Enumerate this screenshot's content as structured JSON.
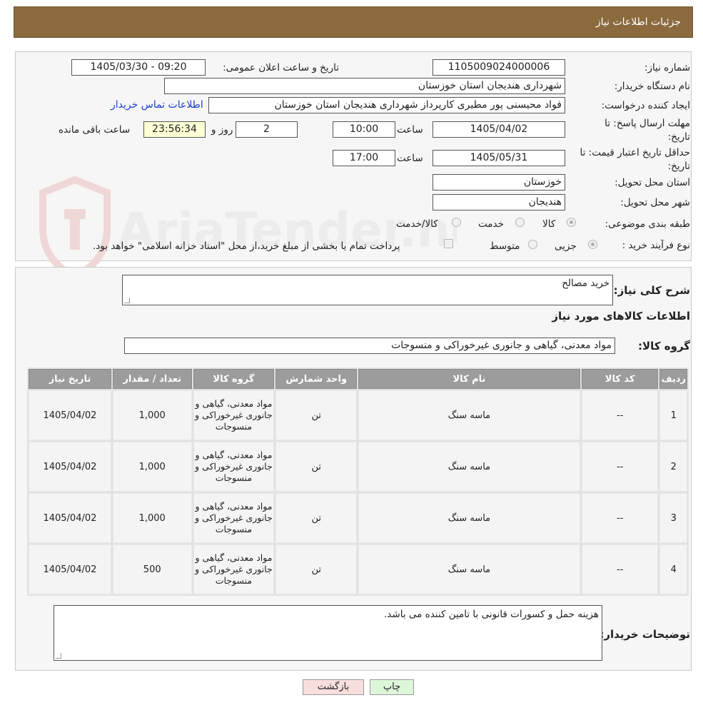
{
  "header": {
    "title": "جزئیات اطلاعات نیاز"
  },
  "form": {
    "need_number_label": "شماره نیاز:",
    "need_number": "1105009024000006",
    "announce_label": "تاریخ و ساعت اعلان عمومی:",
    "announce_value": "1405/03/30 - 09:20",
    "buyer_org_label": "نام دستگاه خریدار:",
    "buyer_org": "شهرداری هندیجان استان خوزستان",
    "requester_label": "ایجاد کننده درخواست:",
    "requester": "فواد محیسنی پور مطیری کارپرداز شهرداری هندیجان استان خوزستان",
    "contact_link": "اطلاعات تماس خریدار",
    "deadline_label": "مهلت ارسال پاسخ: تا تاریخ:",
    "deadline_date": "1405/04/02",
    "time_label": "ساعت",
    "deadline_time": "10:00",
    "days_value": "2",
    "days_label": "روز و",
    "remaining_time": "23:56:34",
    "remaining_label": "ساعت باقی مانده",
    "validity_label": "حداقل تاریخ اعتبار قیمت: تا تاریخ:",
    "validity_date": "1405/05/31",
    "validity_time": "17:00",
    "province_label": "استان محل تحویل:",
    "province": "خوزستان",
    "city_label": "شهر محل تحویل:",
    "city": "هندیجان",
    "category_label": "طبقه بندی موضوعی:",
    "category_options": [
      "کالا",
      "خدمت",
      "کالا/خدمت"
    ],
    "process_label": "نوع فرآیند خرید :",
    "process_options": [
      "جزیی",
      "متوسط"
    ],
    "payment_note": "پرداخت تمام یا بخشی از مبلغ خرید،از محل \"اسناد خزانه اسلامی\" خواهد بود."
  },
  "watermark": {
    "text": "AriaTender.neT"
  },
  "details": {
    "summary_label": "شرح کلی نیاز:",
    "summary_value": "خرید مصالح",
    "items_heading": "اطلاعات کالاهای مورد نیاز",
    "group_label": "گروه کالا:",
    "group_value": "مواد معدنی، گیاهی و جانوری غیرخوراکی و منسوجات",
    "table": {
      "headers": [
        "ردیف",
        "کد کالا",
        "نام کالا",
        "واحد شمارش",
        "گروه کالا",
        "تعداد / مقدار",
        "تاریخ نیاز"
      ],
      "rows": [
        {
          "row": "1",
          "code": "--",
          "name": "ماسه سنگ",
          "unit": "تن",
          "group": "مواد معدنی، گیاهی و جانوری غیرخوراکی و منسوجات",
          "qty": "1,000",
          "date": "1405/04/02"
        },
        {
          "row": "2",
          "code": "--",
          "name": "ماسه سنگ",
          "unit": "تن",
          "group": "مواد معدنی، گیاهی و جانوری غیرخوراکی و منسوجات",
          "qty": "1,000",
          "date": "1405/04/02"
        },
        {
          "row": "3",
          "code": "--",
          "name": "ماسه سنگ",
          "unit": "تن",
          "group": "مواد معدنی، گیاهی و جانوری غیرخوراکی و منسوجات",
          "qty": "1,000",
          "date": "1405/04/02"
        },
        {
          "row": "4",
          "code": "--",
          "name": "ماسه سنگ",
          "unit": "تن",
          "group": "مواد معدنی، گیاهی و جانوری غیرخوراکی و منسوجات",
          "qty": "500",
          "date": "1405/04/02"
        }
      ]
    },
    "notes_label": "توضیحات خریدار:",
    "notes_value": "هزینه حمل و کسورات قانونی با تامین کننده می باشد."
  },
  "buttons": {
    "print": "چاپ",
    "back": "بازگشت"
  }
}
